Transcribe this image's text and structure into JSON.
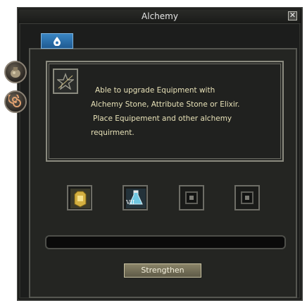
{
  "window": {
    "title": "Alchemy",
    "close_glyph": "✕"
  },
  "tab": {
    "icon": "water-drop-icon",
    "active": true
  },
  "side_buttons": [
    {
      "icon": "alchemy-pouch-icon"
    },
    {
      "icon": "spiral-rune-icon"
    }
  ],
  "info": {
    "icon": "pentagram-star-icon",
    "lines": [
      "Able to upgrade Equipment with",
      "Alchemy Stone, Attribute Stone or Elixir.",
      "Place Equipement and other alchemy",
      "requirment."
    ]
  },
  "slots": [
    {
      "item": "golden-armor-icon",
      "filled": true
    },
    {
      "item": "elixir-potion-icon",
      "filled": true,
      "badge": "VII"
    },
    {
      "item": "empty-slot",
      "filled": false
    },
    {
      "item": "empty-slot",
      "filled": false
    }
  ],
  "progress": {
    "value": 0
  },
  "actions": {
    "strengthen_label": "Strengthen"
  },
  "colors": {
    "text_gold": "#e8e2b8",
    "tab_blue": "#2f74b3",
    "frame": "#1c1d1c"
  }
}
